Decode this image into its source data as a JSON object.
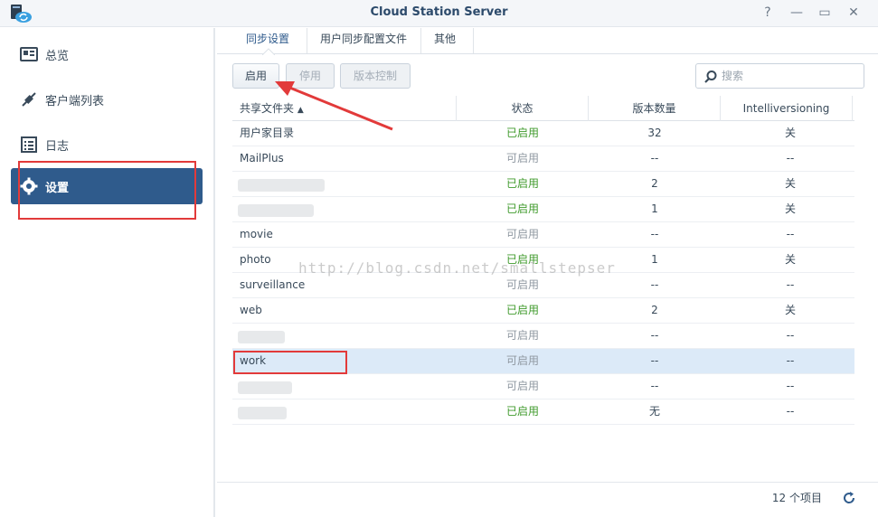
{
  "window": {
    "title": "Cloud Station Server",
    "help": "?",
    "minimize": "—",
    "maximize": "▭",
    "close": "✕"
  },
  "sidebar": {
    "items": [
      {
        "label": "总览",
        "icon": "overview-icon"
      },
      {
        "label": "客户端列表",
        "icon": "client-list-icon"
      },
      {
        "label": "日志",
        "icon": "log-icon"
      },
      {
        "label": "设置",
        "icon": "gear-icon",
        "active": true
      }
    ]
  },
  "tabs": [
    "同步设置",
    "用户同步配置文件",
    "其他"
  ],
  "toolbar": {
    "enable_label": "启用",
    "disable_label": "停用",
    "version_label": "版本控制",
    "search_placeholder": "搜索"
  },
  "table": {
    "headers": {
      "name": "共享文件夹",
      "sort": "▲",
      "status": "状态",
      "count": "版本数量",
      "iv": "Intelliversioning"
    },
    "rows": [
      {
        "name": "用户家目录",
        "status": "已启用",
        "count": "32",
        "iv": "关"
      },
      {
        "name": "MailPlus",
        "status": "可启用",
        "count": "--",
        "iv": "--"
      },
      {
        "name": "",
        "status": "已启用",
        "count": "2",
        "iv": "关"
      },
      {
        "name": "",
        "status": "已启用",
        "count": "1",
        "iv": "关"
      },
      {
        "name": "movie",
        "status": "可启用",
        "count": "--",
        "iv": "--"
      },
      {
        "name": "photo",
        "status": "已启用",
        "count": "1",
        "iv": "关"
      },
      {
        "name": "surveillance",
        "status": "可启用",
        "count": "--",
        "iv": "--"
      },
      {
        "name": "web",
        "status": "已启用",
        "count": "2",
        "iv": "关"
      },
      {
        "name": "",
        "status": "可启用",
        "count": "--",
        "iv": "--"
      },
      {
        "name": "work",
        "status": "可启用",
        "count": "--",
        "iv": "--"
      },
      {
        "name": "",
        "status": "可启用",
        "count": "--",
        "iv": "--"
      },
      {
        "name": "",
        "status": "已启用",
        "count": "无",
        "iv": "--"
      }
    ]
  },
  "footer": {
    "count_text": "12 个项目"
  },
  "watermark": "http://blog.csdn.net/smallstepser",
  "colors": {
    "accent": "#2f5b8c",
    "enabled": "#3f9a2b",
    "available": "#8f98a1",
    "annotation": "#e23a3a"
  }
}
